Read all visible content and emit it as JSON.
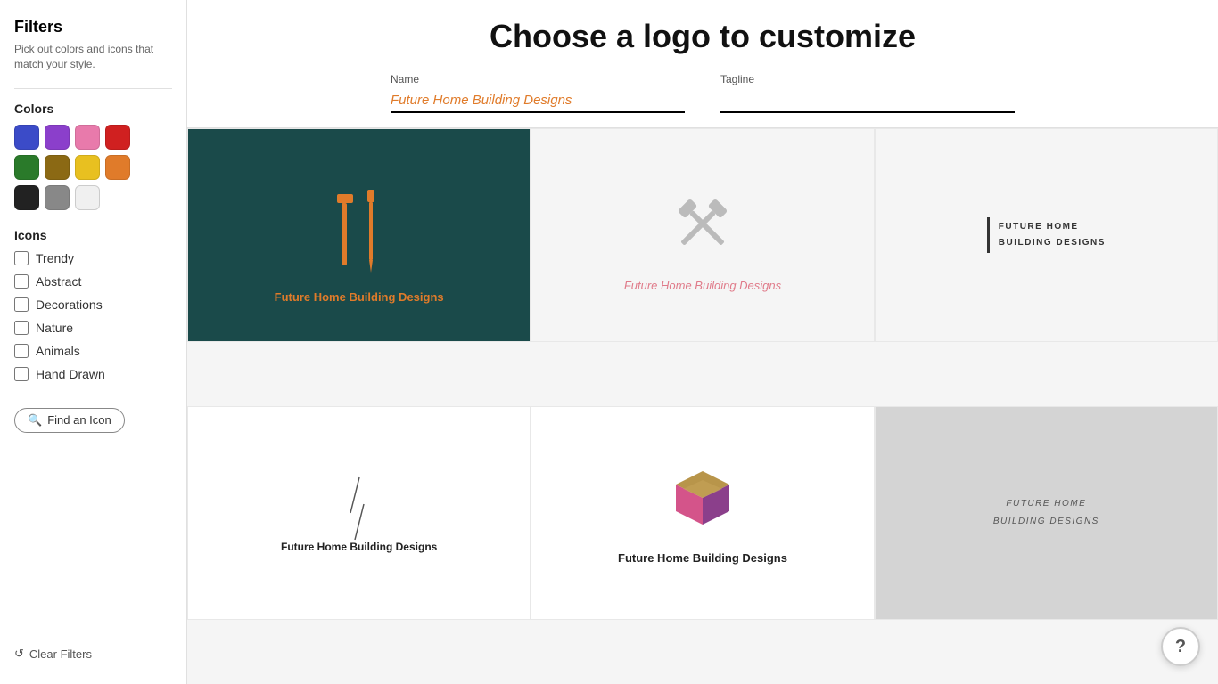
{
  "sidebar": {
    "title": "Filters",
    "subtitle": "Pick out colors and icons that match your style.",
    "colors_label": "Colors",
    "colors": [
      {
        "name": "blue",
        "hex": "#3b4bc8"
      },
      {
        "name": "purple",
        "hex": "#8b3fcb"
      },
      {
        "name": "pink",
        "hex": "#e87aab"
      },
      {
        "name": "red",
        "hex": "#d02020"
      },
      {
        "name": "green",
        "hex": "#2a7a2a"
      },
      {
        "name": "olive",
        "hex": "#8b6914"
      },
      {
        "name": "yellow",
        "hex": "#e8c020"
      },
      {
        "name": "orange",
        "hex": "#e07b2a"
      },
      {
        "name": "black",
        "hex": "#222222"
      },
      {
        "name": "gray",
        "hex": "#888888"
      },
      {
        "name": "white",
        "hex": "#f0f0f0"
      }
    ],
    "icons_label": "Icons",
    "icon_categories": [
      {
        "label": "Trendy",
        "checked": false
      },
      {
        "label": "Abstract",
        "checked": false
      },
      {
        "label": "Decorations",
        "checked": false
      },
      {
        "label": "Nature",
        "checked": false
      },
      {
        "label": "Animals",
        "checked": false
      },
      {
        "label": "Hand Drawn",
        "checked": false
      }
    ],
    "find_icon_label": "Find an Icon",
    "clear_filters_label": "Clear Filters"
  },
  "header": {
    "title": "Choose a logo to customize",
    "name_label": "Name",
    "name_value": "Future Home Building Designs",
    "tagline_label": "Tagline",
    "tagline_value": ""
  },
  "logos": [
    {
      "id": "logo1",
      "type": "tools-dark",
      "company_name": "Future Home Building Designs",
      "bg": "dark"
    },
    {
      "id": "logo2",
      "type": "crossed-hammer",
      "company_name": "Future Home Building Designs",
      "bg": "light"
    },
    {
      "id": "logo3",
      "type": "text-bar",
      "company_name": "Future Home Building Designs",
      "bg": "light"
    },
    {
      "id": "logo4",
      "type": "diagonal-slash",
      "company_name": "Future Home Building Designs",
      "bg": "light"
    },
    {
      "id": "logo5",
      "type": "3d-cube",
      "company_name": "Future Home Building Designs",
      "bg": "light"
    },
    {
      "id": "logo6",
      "type": "gray-text",
      "company_name": "Future Home Building Designs",
      "bg": "gray"
    }
  ],
  "help_btn": "?"
}
